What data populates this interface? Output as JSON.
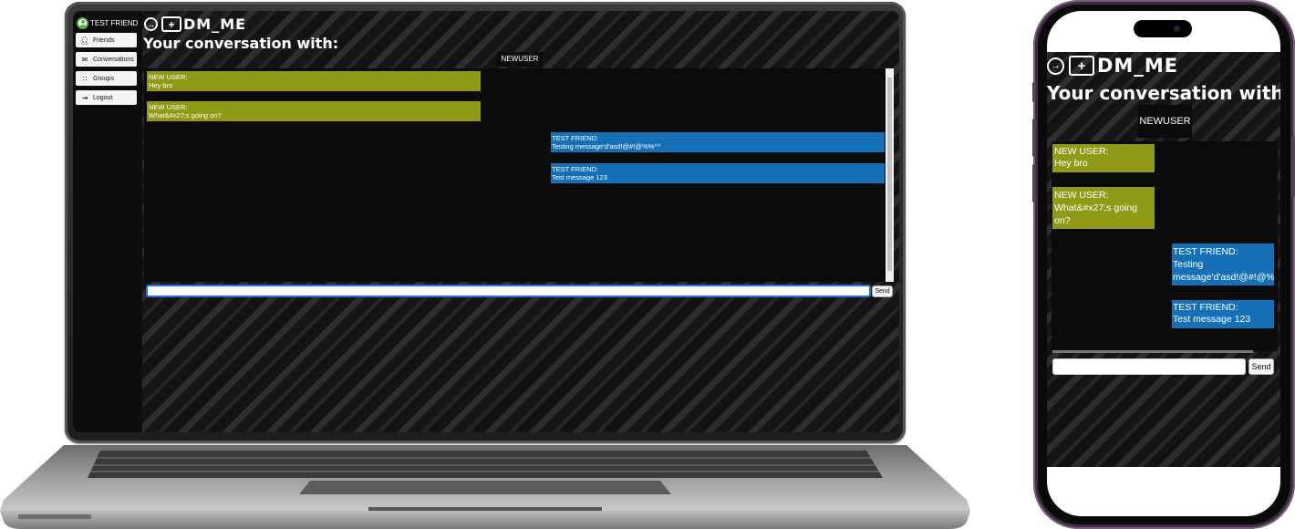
{
  "app": {
    "logo_text": "DM_ME",
    "heading": "Your conversation with:",
    "peer": "NEWUSER"
  },
  "sidebar": {
    "user": "TEST FRIEND",
    "items": [
      {
        "label": "Friends",
        "icon": "person-icon"
      },
      {
        "label": "Conversations",
        "icon": "envelope-icon"
      },
      {
        "label": "Groups",
        "icon": "group-icon"
      },
      {
        "label": "Logout",
        "icon": "logout-icon"
      }
    ]
  },
  "messages": [
    {
      "sender": "NEW USER:",
      "text": "Hey bro",
      "direction": "in"
    },
    {
      "sender": "NEW USER:",
      "text": "What&#x27;s going on?",
      "direction": "in"
    },
    {
      "sender": "TEST FRIEND:",
      "text": "Testing message'd'asd!@#!@%%^^",
      "direction": "out"
    },
    {
      "sender": "TEST FRIEND:",
      "text": "Test message 123",
      "direction": "out"
    }
  ],
  "composer": {
    "value": "",
    "send_label": "Send"
  },
  "colors": {
    "incoming": "#909a17",
    "outgoing": "#1570b8",
    "background": "#1c1c1c",
    "focus": "#2b6fd6"
  }
}
